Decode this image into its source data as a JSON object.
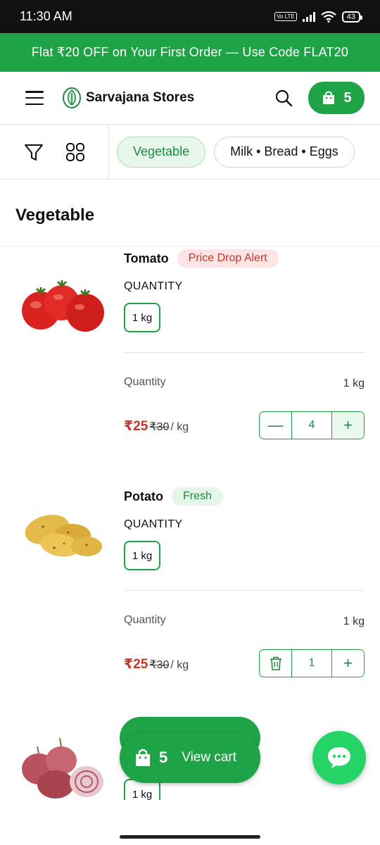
{
  "status_bar": {
    "time": "11:30 AM",
    "lte": "Vo LTE",
    "battery": "43"
  },
  "promo": {
    "text": "Flat ₹20 OFF on Your First Order — Use Code FLAT20"
  },
  "header": {
    "store_name": "Sarvajana Stores",
    "cart_count": "5",
    "icons": [
      "menu-icon",
      "leaf-logo",
      "search-icon",
      "bag-icon"
    ]
  },
  "filters": {
    "icons": [
      "filter-icon",
      "grid-icon"
    ],
    "chips": [
      "Vegetable",
      "Milk • Bread • Eggs"
    ],
    "active": "Vegetable"
  },
  "section": {
    "title": "Vegetable"
  },
  "products": [
    {
      "name": "Tomato",
      "tag": "Price Drop Alert",
      "quantity_label": "QUANTITY",
      "unit": "1 kg",
      "q_label": "Quantity",
      "q_value": "1 kg",
      "price": "₹25",
      "mrp": "₹30",
      "per": "/ kg",
      "count": "4"
    },
    {
      "name": "Potato",
      "tag": "Fresh",
      "quantity_label": "QUANTITY",
      "unit": "1 kg",
      "q_label": "Quantity",
      "q_value": "1 kg",
      "price": "₹25",
      "mrp": "₹30",
      "per": "/ kg",
      "count": "1"
    },
    {
      "unit": "1 kg"
    }
  ],
  "floating_cart": {
    "count": "5",
    "label": "View cart"
  },
  "colors": {
    "brand": "#1fa347",
    "price": "#c0392b",
    "chat": "#25d366"
  }
}
